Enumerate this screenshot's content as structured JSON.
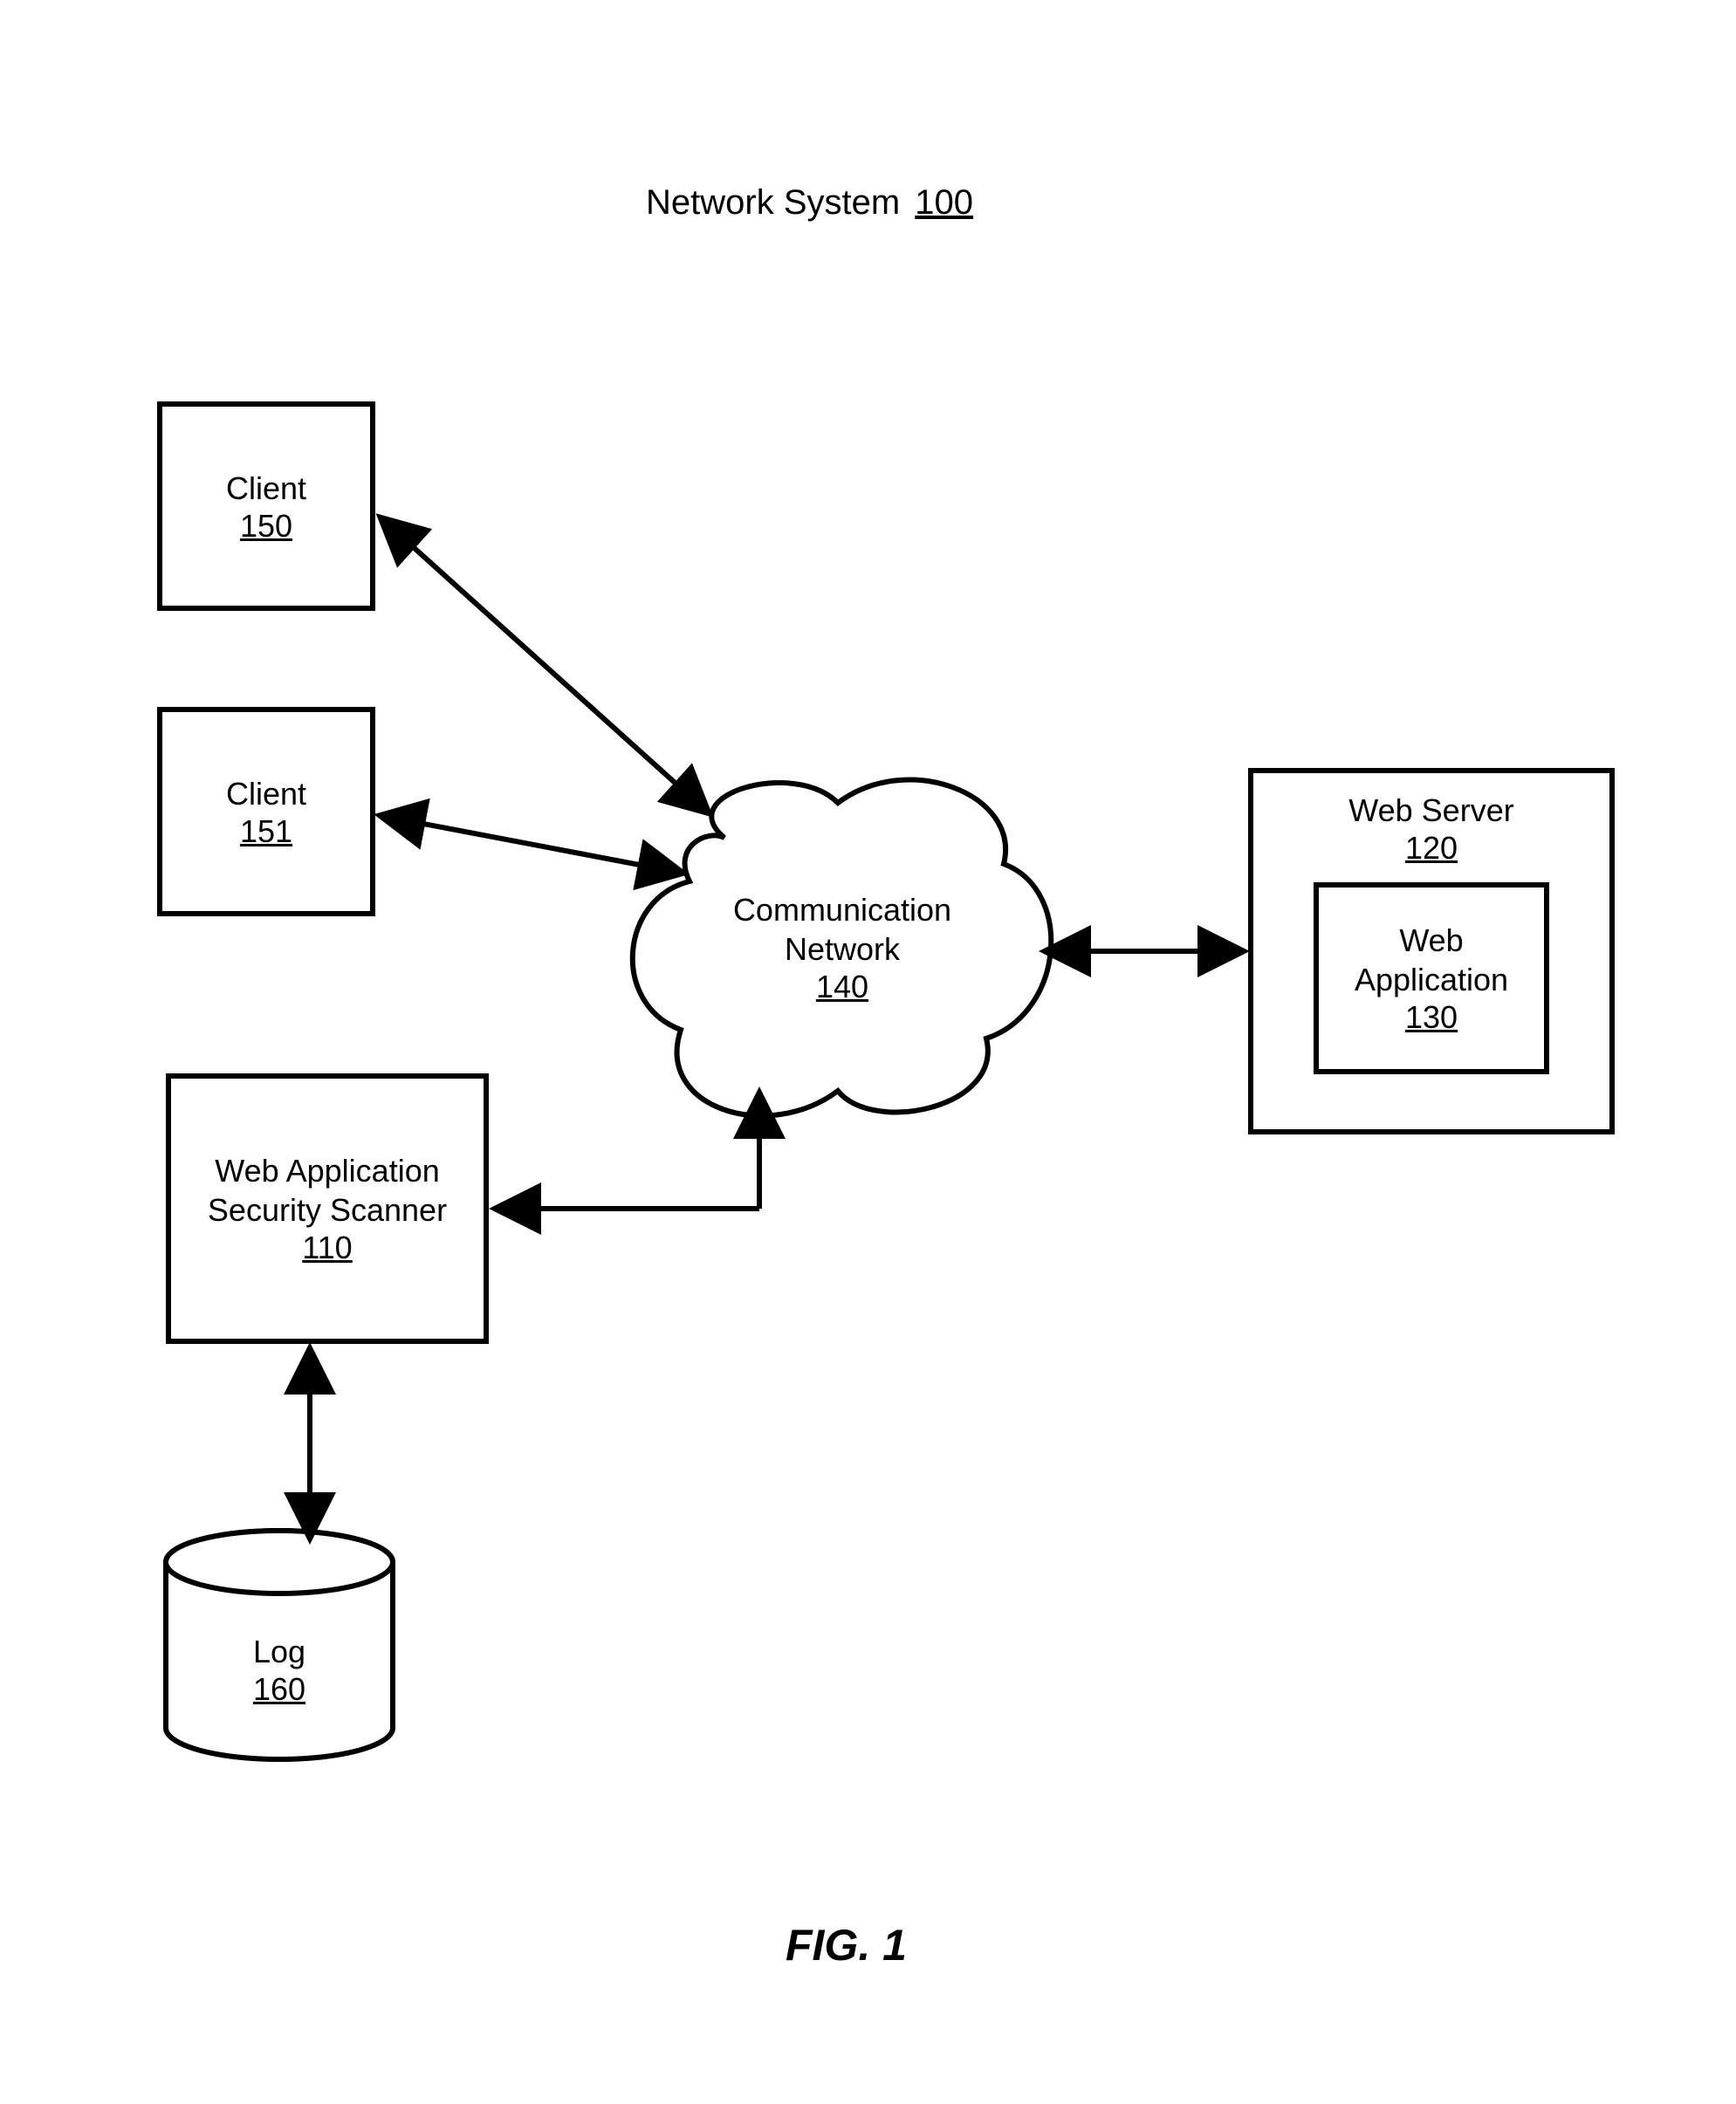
{
  "title": {
    "text": "Network System",
    "num": "100"
  },
  "figure": "FIG. 1",
  "nodes": {
    "client1": {
      "label": "Client",
      "num": "150"
    },
    "client2": {
      "label": "Client",
      "num": "151"
    },
    "scanner": {
      "line1": "Web Application",
      "line2": "Security Scanner",
      "num": "110"
    },
    "log": {
      "label": "Log",
      "num": "160"
    },
    "network": {
      "line1": "Communication",
      "line2": "Network",
      "num": "140"
    },
    "webserver": {
      "label": "Web Server",
      "num": "120"
    },
    "webapp": {
      "line1": "Web",
      "line2": "Application",
      "num": "130"
    }
  }
}
